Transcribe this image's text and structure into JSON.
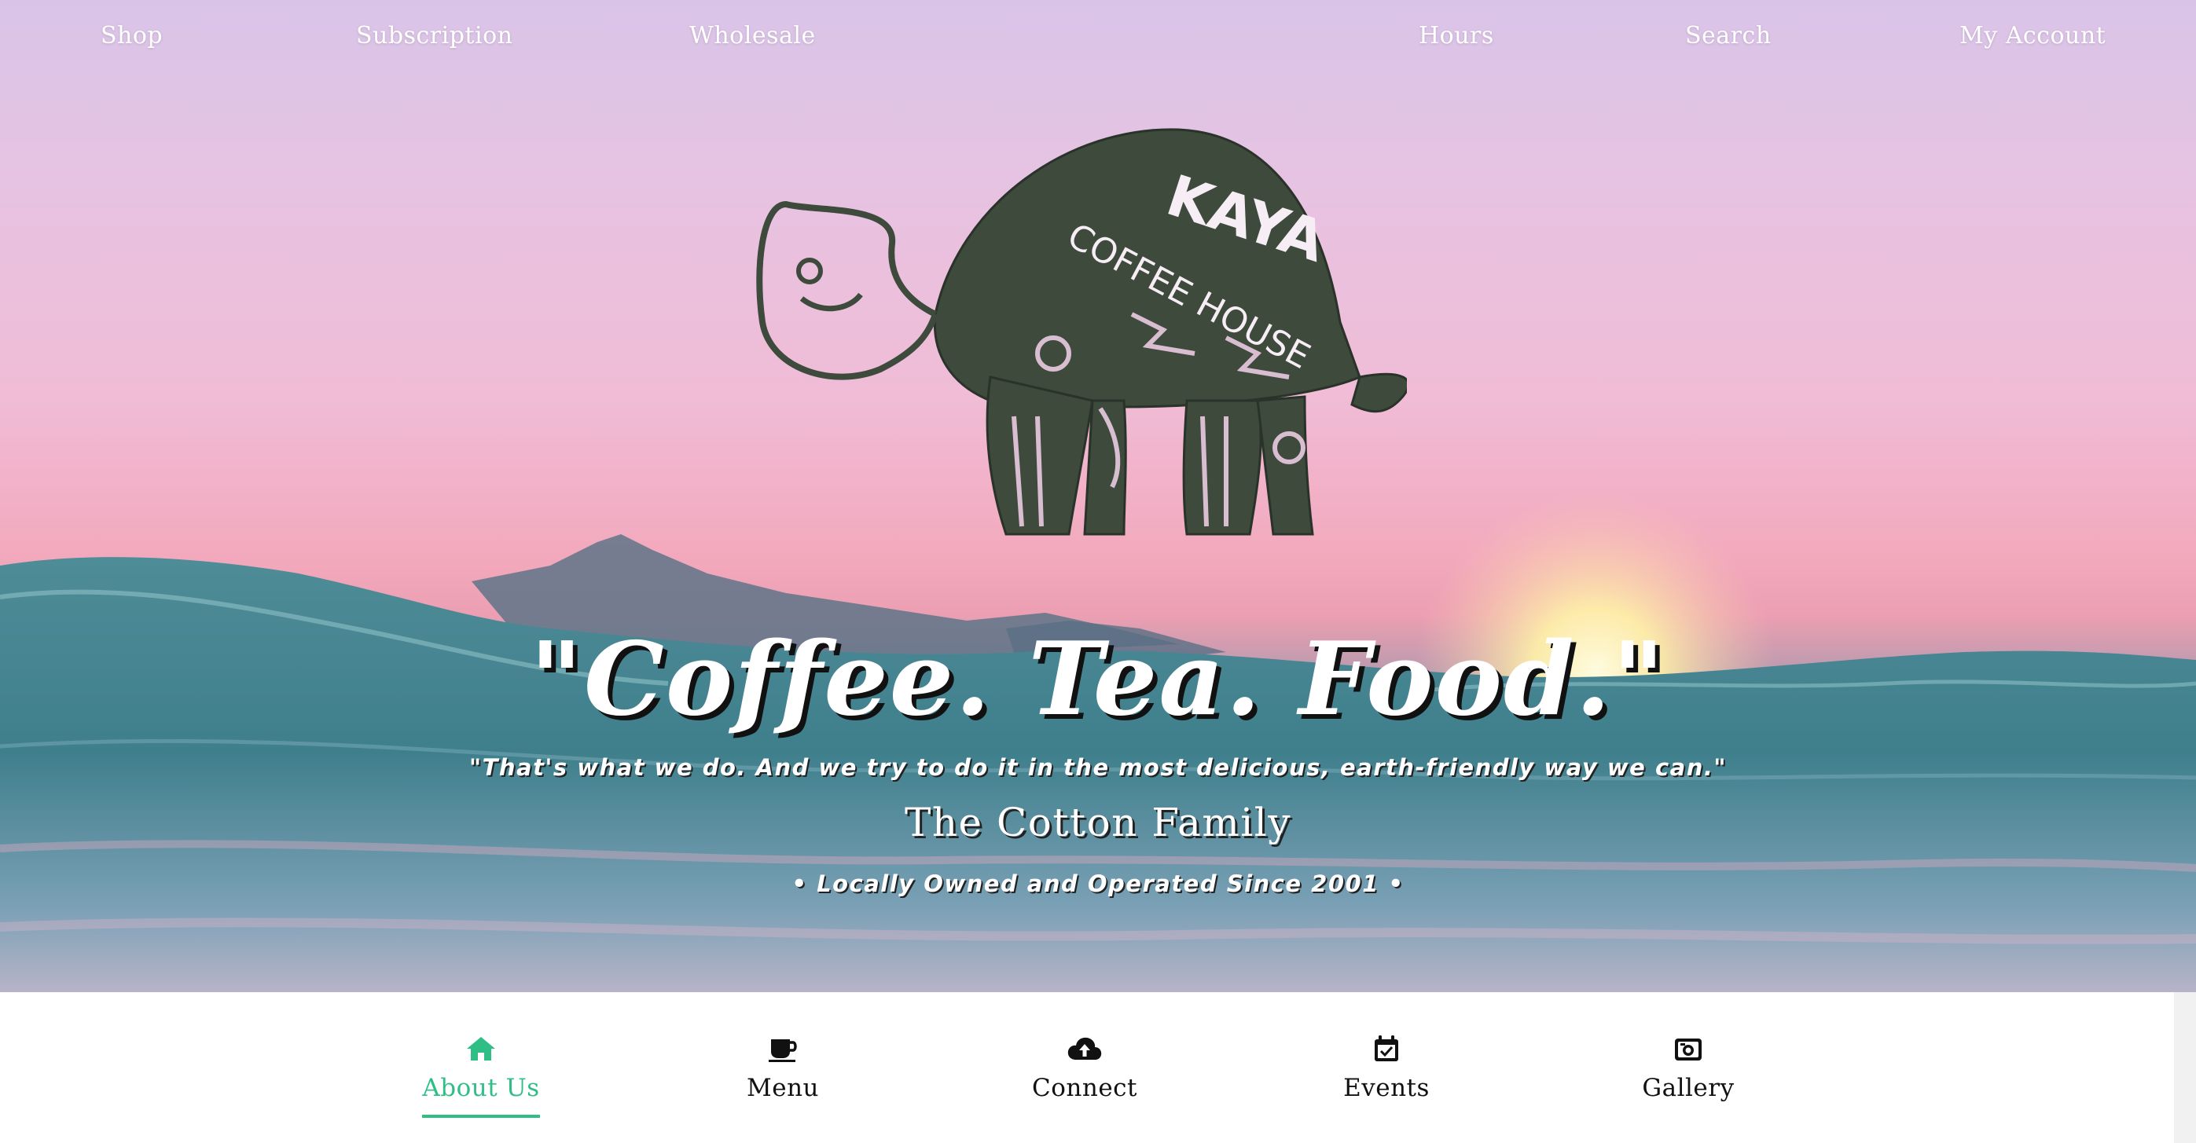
{
  "top_nav": {
    "items": [
      "Shop",
      "Subscription",
      "Wholesale",
      "Hours",
      "Search",
      "My Account"
    ]
  },
  "logo": {
    "line1": "KAYA",
    "line2": "COFFEE HOUSE"
  },
  "hero": {
    "headline": "\"Coffee. Tea. Food.\"",
    "quote": "\"That's what we do. And we try to do it in the most delicious, earth-friendly way we can.\"",
    "attribution": "The Cotton Family",
    "since": "• Locally Owned and Operated Since 2001 •"
  },
  "bottom_nav": {
    "items": [
      {
        "label": "About Us",
        "icon": "home-icon",
        "active": true
      },
      {
        "label": "Menu",
        "icon": "coffee-cup-icon",
        "active": false
      },
      {
        "label": "Connect",
        "icon": "cloud-upload-icon",
        "active": false
      },
      {
        "label": "Events",
        "icon": "calendar-check-icon",
        "active": false
      },
      {
        "label": "Gallery",
        "icon": "camera-icon",
        "active": false
      }
    ]
  },
  "colors": {
    "accent": "#2fbf86",
    "text_dark": "#111111",
    "hero_text": "#ffffff"
  }
}
